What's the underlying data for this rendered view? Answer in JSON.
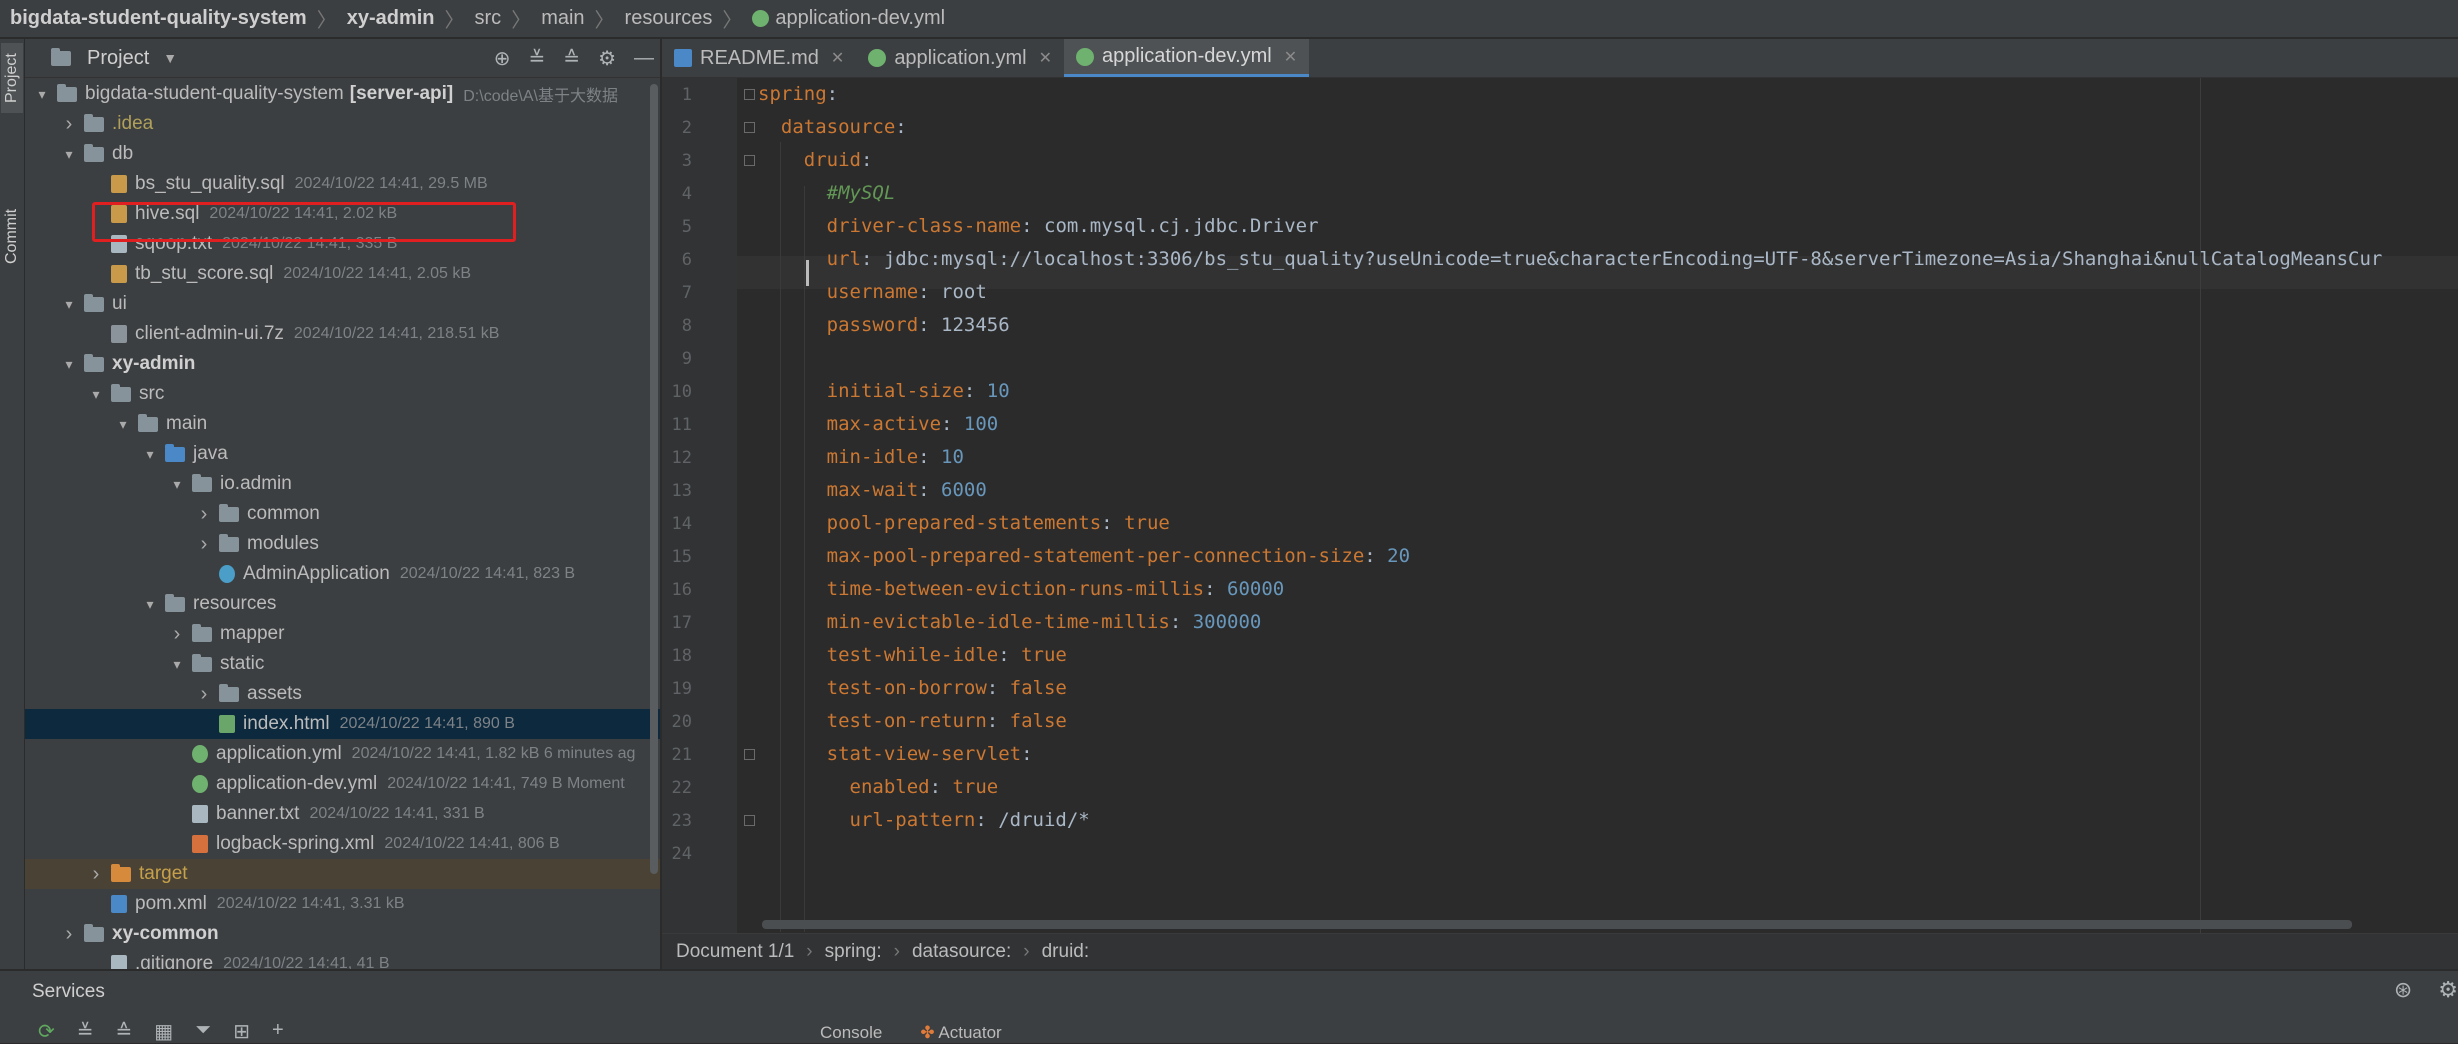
{
  "breadcrumb": [
    "bigdata-student-quality-system",
    "xy-admin",
    "src",
    "main",
    "resources",
    "application-dev.yml"
  ],
  "sidebar_tabs": {
    "project": "Project",
    "commit": "Commit"
  },
  "project_panel": {
    "title": "Project",
    "tree": [
      {
        "name": "bigdata-student-quality-system",
        "suffix": "[server-api]",
        "meta": "D:\\code\\A\\基于大数据",
        "depth": 0,
        "kind": "folder",
        "open": true
      },
      {
        "name": ".idea",
        "depth": 1,
        "kind": "folder",
        "arrow": "closed"
      },
      {
        "name": "db",
        "depth": 1,
        "kind": "folder",
        "open": true
      },
      {
        "name": "bs_stu_quality.sql",
        "meta": "2024/10/22 14:41, 29.5 MB",
        "depth": 2,
        "kind": "sql"
      },
      {
        "name": "hive.sql",
        "meta": "2024/10/22 14:41, 2.02 kB",
        "depth": 2,
        "kind": "sql"
      },
      {
        "name": "sqoop.txt",
        "meta": "2024/10/22 14:41, 335 B",
        "depth": 2,
        "kind": "txt"
      },
      {
        "name": "tb_stu_score.sql",
        "meta": "2024/10/22 14:41, 2.05 kB",
        "depth": 2,
        "kind": "sql"
      },
      {
        "name": "ui",
        "depth": 1,
        "kind": "folder",
        "open": true
      },
      {
        "name": "client-admin-ui.7z",
        "meta": "2024/10/22 14:41, 218.51 kB",
        "depth": 2,
        "kind": "zip"
      },
      {
        "name": "xy-admin",
        "depth": 1,
        "kind": "folder",
        "open": true,
        "bold": true
      },
      {
        "name": "src",
        "depth": 2,
        "kind": "folder",
        "open": true
      },
      {
        "name": "main",
        "depth": 3,
        "kind": "folder",
        "open": true
      },
      {
        "name": "java",
        "depth": 4,
        "kind": "folder-blue",
        "open": true
      },
      {
        "name": "io.admin",
        "depth": 5,
        "kind": "folder",
        "open": true
      },
      {
        "name": "common",
        "depth": 6,
        "kind": "folder",
        "arrow": "closed"
      },
      {
        "name": "modules",
        "depth": 6,
        "kind": "folder",
        "arrow": "closed"
      },
      {
        "name": "AdminApplication",
        "meta": "2024/10/22 14:41, 823 B",
        "depth": 6,
        "kind": "java"
      },
      {
        "name": "resources",
        "depth": 4,
        "kind": "folder",
        "open": true
      },
      {
        "name": "mapper",
        "depth": 5,
        "kind": "folder",
        "arrow": "closed"
      },
      {
        "name": "static",
        "depth": 5,
        "kind": "folder",
        "open": true
      },
      {
        "name": "assets",
        "depth": 6,
        "kind": "folder",
        "arrow": "closed"
      },
      {
        "name": "index.html",
        "meta": "2024/10/22 14:41, 890 B",
        "depth": 6,
        "kind": "html",
        "selected": true
      },
      {
        "name": "application.yml",
        "meta": "2024/10/22 14:41, 1.82 kB 6 minutes ag",
        "depth": 5,
        "kind": "yml"
      },
      {
        "name": "application-dev.yml",
        "meta": "2024/10/22 14:41, 749 B Moment",
        "depth": 5,
        "kind": "yml"
      },
      {
        "name": "banner.txt",
        "meta": "2024/10/22 14:41, 331 B",
        "depth": 5,
        "kind": "txt"
      },
      {
        "name": "logback-spring.xml",
        "meta": "2024/10/22 14:41, 806 B",
        "depth": 5,
        "kind": "xml"
      },
      {
        "name": "target",
        "depth": 2,
        "kind": "folder-orange",
        "arrow": "closed",
        "target": true
      },
      {
        "name": "pom.xml",
        "meta": "2024/10/22 14:41, 3.31 kB",
        "depth": 2,
        "kind": "pom"
      },
      {
        "name": "xy-common",
        "depth": 1,
        "kind": "folder",
        "arrow": "closed",
        "bold": true
      },
      {
        "name": ".gitignore",
        "meta": "2024/10/22 14:41, 41 B",
        "depth": 2,
        "kind": "txt"
      }
    ]
  },
  "editor_tabs": [
    {
      "label": "README.md",
      "icon": "markdown-icon",
      "active": false
    },
    {
      "label": "application.yml",
      "icon": "spring-yml-icon",
      "active": false
    },
    {
      "label": "application-dev.yml",
      "icon": "spring-yml-icon",
      "active": true
    }
  ],
  "code_lines": [
    [
      {
        "t": "spring",
        "c": "k"
      },
      {
        "t": ":",
        "c": "p"
      }
    ],
    [
      {
        "t": "  datasource",
        "c": "k"
      },
      {
        "t": ":",
        "c": "p"
      }
    ],
    [
      {
        "t": "    druid",
        "c": "k"
      },
      {
        "t": ":",
        "c": "p"
      }
    ],
    [
      {
        "t": "      #MySQL",
        "c": "c"
      }
    ],
    [
      {
        "t": "      driver-class-name",
        "c": "k"
      },
      {
        "t": ": ",
        "c": "p"
      },
      {
        "t": "com.mysql.cj.jdbc.Driver",
        "c": "v"
      }
    ],
    [
      {
        "t": "      url",
        "c": "k"
      },
      {
        "t": ": ",
        "c": "p"
      },
      {
        "t": "jdbc:mysql://localhost:3306/bs_stu_quality?useUnicode=true&characterEncoding=UTF-8&serverTimezone=Asia/Shanghai&nullCatalogMeansCur",
        "c": "v"
      }
    ],
    [
      {
        "t": "      username",
        "c": "k"
      },
      {
        "t": ": ",
        "c": "p"
      },
      {
        "t": "root",
        "c": "v"
      }
    ],
    [
      {
        "t": "      password",
        "c": "k"
      },
      {
        "t": ": ",
        "c": "p"
      },
      {
        "t": "123456",
        "c": "v"
      }
    ],
    [],
    [
      {
        "t": "      initial-size",
        "c": "k"
      },
      {
        "t": ": ",
        "c": "p"
      },
      {
        "t": "10",
        "c": "n"
      }
    ],
    [
      {
        "t": "      max-active",
        "c": "k"
      },
      {
        "t": ": ",
        "c": "p"
      },
      {
        "t": "100",
        "c": "n"
      }
    ],
    [
      {
        "t": "      min-idle",
        "c": "k"
      },
      {
        "t": ": ",
        "c": "p"
      },
      {
        "t": "10",
        "c": "n"
      }
    ],
    [
      {
        "t": "      max-wait",
        "c": "k"
      },
      {
        "t": ": ",
        "c": "p"
      },
      {
        "t": "6000",
        "c": "n"
      }
    ],
    [
      {
        "t": "      pool-prepared-statements",
        "c": "k"
      },
      {
        "t": ": ",
        "c": "p"
      },
      {
        "t": "true",
        "c": "k"
      }
    ],
    [
      {
        "t": "      max-pool-prepared-statement-per-connection-size",
        "c": "k"
      },
      {
        "t": ": ",
        "c": "p"
      },
      {
        "t": "20",
        "c": "n"
      }
    ],
    [
      {
        "t": "      time-between-eviction-runs-millis",
        "c": "k"
      },
      {
        "t": ": ",
        "c": "p"
      },
      {
        "t": "60000",
        "c": "n"
      }
    ],
    [
      {
        "t": "      min-evictable-idle-time-millis",
        "c": "k"
      },
      {
        "t": ": ",
        "c": "p"
      },
      {
        "t": "300000",
        "c": "n"
      }
    ],
    [
      {
        "t": "      test-while-idle",
        "c": "k"
      },
      {
        "t": ": ",
        "c": "p"
      },
      {
        "t": "true",
        "c": "k"
      }
    ],
    [
      {
        "t": "      test-on-borrow",
        "c": "k"
      },
      {
        "t": ": ",
        "c": "p"
      },
      {
        "t": "false",
        "c": "k"
      }
    ],
    [
      {
        "t": "      test-on-return",
        "c": "k"
      },
      {
        "t": ": ",
        "c": "p"
      },
      {
        "t": "false",
        "c": "k"
      }
    ],
    [
      {
        "t": "      stat-view-servlet",
        "c": "k"
      },
      {
        "t": ":",
        "c": "p"
      }
    ],
    [
      {
        "t": "        enabled",
        "c": "k"
      },
      {
        "t": ": ",
        "c": "p"
      },
      {
        "t": "true",
        "c": "k"
      }
    ],
    [
      {
        "t": "        url-pattern",
        "c": "k"
      },
      {
        "t": ": ",
        "c": "p"
      },
      {
        "t": "/druid/*",
        "c": "v"
      }
    ],
    []
  ],
  "editor_breadcrumb": [
    "Document 1/1",
    "spring:",
    "datasource:",
    "druid:"
  ],
  "services": {
    "title": "Services",
    "tabs": [
      "Console",
      "Actuator"
    ]
  },
  "colors": {
    "accent": "#4a88c7",
    "highlight_box": "#e02020",
    "keyword": "#cc7832",
    "number": "#6897bb",
    "comment": "#629755"
  }
}
